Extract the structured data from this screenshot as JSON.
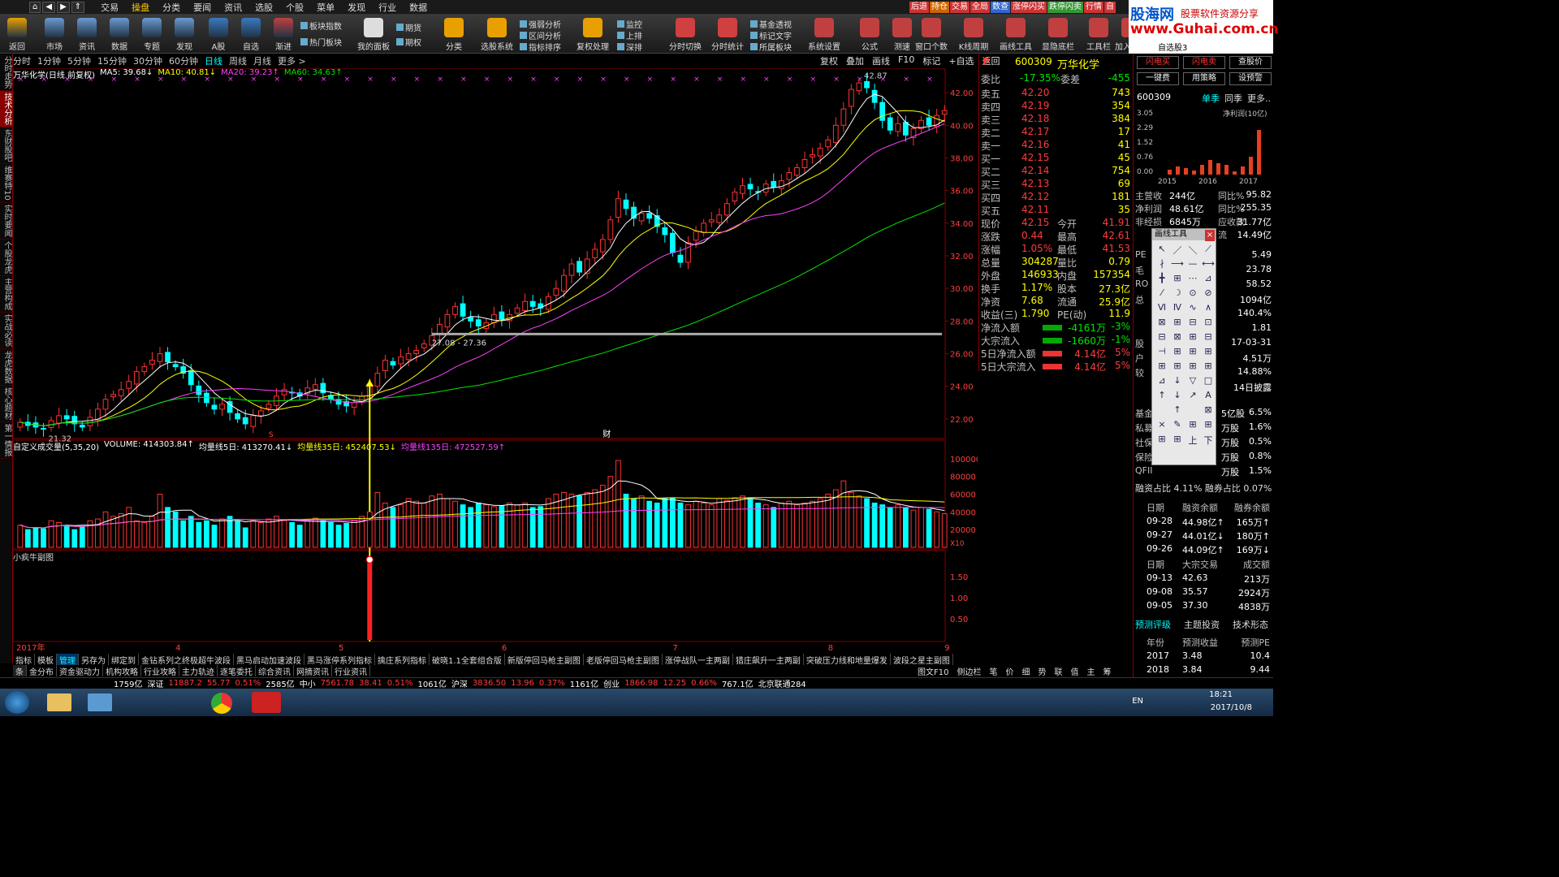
{
  "menu": {
    "items": [
      "交易",
      "操盘",
      "分类",
      "要闻",
      "资讯",
      "选股",
      "个股",
      "菜单",
      "发现",
      "行业",
      "数据"
    ],
    "active": "操盘",
    "tags": [
      "后退",
      "持仓",
      "交易",
      "全局",
      "数查",
      "涨停闪买",
      "跌停闪卖",
      "行情",
      "自"
    ]
  },
  "toolbar": {
    "big": [
      "返回",
      "市场",
      "资讯",
      "数据",
      "专题",
      "发现",
      "A股",
      "自选",
      "渐进"
    ],
    "small_left": [
      "板块指数",
      "热门板块"
    ],
    "panel": "我的面板",
    "futures": [
      "期货",
      "期权"
    ],
    "fenlei": "分类",
    "analysis": [
      "强弱分析",
      "区间分析",
      "指标排序"
    ],
    "select": "选股系统",
    "fuquan": "复权处理",
    "monitor": [
      "监控",
      "上排",
      "深排"
    ],
    "fenshi": [
      "分时切换",
      "分时统计"
    ],
    "jijin": [
      "基金透视",
      "标记文字",
      "所属板块"
    ],
    "more": [
      "系统设置",
      "公式",
      "测速",
      "窗口个数",
      "K线周期",
      "画线工具",
      "显隐底栏",
      "工具栏",
      "加入自选",
      "自选股3"
    ]
  },
  "brand": {
    "line1": "股海网",
    "line2": "股票软件资源分享",
    "line3": "www.Guhai.com.cn"
  },
  "periods": [
    "分时",
    "1分钟",
    "5分钟",
    "15分钟",
    "30分钟",
    "60分钟",
    "日线",
    "周线",
    "月线",
    "更多 >"
  ],
  "period_selected": "日线",
  "chart_buttons": [
    "复权",
    "叠加",
    "画线",
    "F10",
    "标记",
    "+自选",
    "返回"
  ],
  "left_tabs": [
    "分时走势",
    "技术分析",
    "东财股吧",
    "维赛特10",
    "实时要闻",
    "个股龙虎",
    "主营构成",
    "实战必读",
    "龙虎数据",
    "核心题材",
    "第一情报"
  ],
  "ma_legend": {
    "title": "万华化学(日线 前复权)",
    "ma5": "MA5: 39.68↓",
    "ma10": "MA10: 40.81↓",
    "ma20": "MA20: 39.23↑",
    "ma60": "MA60: 34.63↑",
    "colors": {
      "ma5": "#ffffff",
      "ma10": "#ffff00",
      "ma20": "#ff40ff",
      "ma60": "#00e600"
    }
  },
  "vol_legend": {
    "title": "自定义成交量(5,35,20)",
    "vol": "VOLUME: 414303.84↑",
    "v5": "均量线5日: 413270.41↓",
    "v35": "均量线35日: 452407.53↓",
    "v135": "均量线135日: 472527.59↑"
  },
  "indicator_name": "小疯牛副图",
  "price_axis": [
    "42.00",
    "40.00",
    "38.00",
    "36.00",
    "34.00",
    "32.00",
    "30.00",
    "28.00",
    "26.00",
    "24.00",
    "22.00"
  ],
  "vol_axis": [
    "100000",
    "80000",
    "60000",
    "40000",
    "20000"
  ],
  "vol_unit": "X10",
  "ind_axis": [
    "1.50",
    "1.00",
    "0.50"
  ],
  "month_labels": [
    "2017年",
    "4",
    "5",
    "6",
    "7",
    "8",
    "9"
  ],
  "annotations": {
    "low": "21.32",
    "high": "42.87",
    "range": "27.08 - 27.36",
    "marker": "财",
    "marker2": "S"
  },
  "chart_data": {
    "type": "candlestick",
    "title": "万华化学(日线 前复权)",
    "ylim": [
      21,
      43
    ],
    "closes": [
      21.8,
      21.6,
      21.5,
      21.4,
      21.9,
      22.2,
      22.0,
      21.7,
      21.5,
      22.1,
      22.6,
      23.2,
      23.5,
      23.8,
      24.3,
      24.9,
      25.2,
      25.6,
      26.0,
      25.5,
      25.2,
      24.8,
      24.1,
      23.5,
      23.0,
      22.6,
      22.9,
      22.4,
      22.0,
      21.7,
      22.2,
      22.5,
      22.9,
      23.4,
      23.8,
      23.6,
      23.4,
      23.9,
      24.1,
      23.6,
      23.2,
      22.9,
      22.8,
      23.0,
      23.4,
      24.0,
      24.8,
      25.6,
      25.3,
      25.8,
      26.0,
      26.2,
      26.6,
      27.1,
      27.8,
      28.4,
      28.9,
      28.3,
      28.0,
      27.7,
      27.9,
      28.4,
      28.1,
      28.4,
      28.8,
      29.2,
      28.9,
      28.8,
      29.5,
      30.0,
      30.8,
      31.5,
      31.0,
      31.8,
      32.4,
      33.0,
      34.2,
      35.5,
      34.9,
      34.3,
      34.6,
      34.3,
      33.8,
      33.3,
      32.2,
      31.6,
      32.8,
      33.5,
      34.0,
      34.2,
      34.5,
      35.2,
      35.9,
      36.3,
      36.1,
      35.9,
      36.4,
      36.2,
      36.6,
      37.1,
      37.4,
      37.9,
      38.2,
      38.6,
      39.1,
      40.0,
      41.0,
      42.2,
      42.6,
      42.3,
      41.4,
      40.3,
      39.7,
      40.1,
      39.4,
      39.8,
      40.3,
      40.0,
      40.6,
      40.9
    ],
    "volumes": [
      25000,
      20000,
      22000,
      21000,
      30000,
      28000,
      24000,
      20000,
      23000,
      30000,
      32000,
      40000,
      35000,
      38000,
      45000,
      30000,
      28000,
      35000,
      60000,
      45000,
      40000,
      30000,
      35000,
      28000,
      30000,
      25000,
      32000,
      35000,
      30000,
      22000,
      30000,
      28000,
      32000,
      35000,
      30000,
      28000,
      25000,
      30000,
      33000,
      30000,
      28000,
      25000,
      27000,
      30000,
      35000,
      40000,
      62000,
      50000,
      45000,
      48000,
      55000,
      52000,
      50000,
      58000,
      60000,
      55000,
      52000,
      48000,
      45000,
      50000,
      48000,
      46000,
      47000,
      50000,
      48000,
      50000,
      45000,
      46000,
      55000,
      60000,
      62000,
      60000,
      58000,
      62000,
      65000,
      70000,
      80000,
      98000,
      60000,
      55000,
      58000,
      52000,
      50000,
      55000,
      55000,
      50000,
      48000,
      52000,
      50000,
      48000,
      55000,
      53000,
      56000,
      58000,
      55000,
      50000,
      48000,
      45000,
      50000,
      52000,
      48000,
      50000,
      52000,
      55000,
      60000,
      65000,
      75000,
      62000,
      58000,
      55000,
      50000,
      48000,
      45000,
      48000,
      45000,
      42000,
      45000,
      43000,
      40000,
      38000
    ]
  },
  "quote": {
    "flag": "P",
    "code": "600309",
    "name": "万华化学",
    "weibi_label": "委比",
    "weibi": "-17.35%",
    "weicha_label": "委差",
    "weicha": "-455",
    "asks": [
      {
        "l": "卖五",
        "p": "42.20",
        "v": "743"
      },
      {
        "l": "卖四",
        "p": "42.19",
        "v": "354"
      },
      {
        "l": "卖三",
        "p": "42.18",
        "v": "384"
      },
      {
        "l": "卖二",
        "p": "42.17",
        "v": "17"
      },
      {
        "l": "卖一",
        "p": "42.16",
        "v": "41"
      }
    ],
    "bids": [
      {
        "l": "买一",
        "p": "42.15",
        "v": "45"
      },
      {
        "l": "买二",
        "p": "42.14",
        "v": "754"
      },
      {
        "l": "买三",
        "p": "42.13",
        "v": "69"
      },
      {
        "l": "买四",
        "p": "42.12",
        "v": "181"
      },
      {
        "l": "买五",
        "p": "42.11",
        "v": "35"
      }
    ],
    "stats": [
      {
        "a": "现价",
        "b": "42.15",
        "c": "今开",
        "d": "41.91"
      },
      {
        "a": "涨跌",
        "b": "0.44",
        "c": "最高",
        "d": "42.61"
      },
      {
        "a": "涨幅",
        "b": "1.05%",
        "c": "最低",
        "d": "41.53"
      },
      {
        "a": "总量",
        "b": "304287",
        "c": "量比",
        "d": "0.79"
      },
      {
        "a": "外盘",
        "b": "146933",
        "c": "内盘",
        "d": "157354"
      },
      {
        "a": "换手",
        "b": "1.17%",
        "c": "股本",
        "d": "27.3亿"
      },
      {
        "a": "净资",
        "b": "7.68",
        "c": "流通",
        "d": "25.9亿"
      },
      {
        "a": "收益(三)",
        "b": "1.790",
        "c": "PE(动)",
        "d": "11.9"
      }
    ],
    "flows": [
      {
        "a": "净流入额",
        "b": "-4161万",
        "c": "-3%"
      },
      {
        "a": "大宗流入",
        "b": "-1660万",
        "c": "-1%"
      },
      {
        "a": "5日净流入额",
        "b": "4.14亿",
        "c": "5%"
      },
      {
        "a": "5日大宗流入",
        "b": "4.14亿",
        "c": "5%"
      }
    ]
  },
  "rpanel": {
    "buttons": [
      "闪电买",
      "闪电卖",
      "查股价",
      "一键费",
      "用策略",
      "设预警"
    ],
    "code": "600309",
    "tabs": [
      "单季",
      "同季",
      "更多.."
    ],
    "chart_title": "净利润(10亿)",
    "chart_axis": [
      "3.05",
      "2.29",
      "1.52",
      "0.76",
      "0.00"
    ],
    "years": [
      "2015",
      "2016",
      "2017"
    ],
    "rows": [
      {
        "a": "主营收",
        "b": "244亿",
        "c": "同比%",
        "d": "95.82"
      },
      {
        "a": "净利润",
        "b": "48.61亿",
        "c": "同比%",
        "d": "255.35"
      },
      {
        "a": "非经损",
        "b": "6845万",
        "c": "应收款",
        "d": "31.77亿"
      },
      {
        "a": "",
        "b": "",
        "c": "流",
        "d": "14.49亿"
      }
    ],
    "partial": [
      {
        "a": "PE",
        "d": "5.49"
      },
      {
        "a": "毛",
        "d": "23.78"
      },
      {
        "a": "RO",
        "d": "58.52"
      },
      {
        "a": "总",
        "d": "1094亿"
      },
      {
        "a": "",
        "d": "140.4%"
      },
      {
        "a": "",
        "d": "1.81"
      },
      {
        "a": "股",
        "d": "17-03-31"
      },
      {
        "a": "户",
        "d": "4.51万"
      },
      {
        "a": "较",
        "d": "14.88%"
      },
      {
        "a": "",
        "d": "14日披露"
      }
    ],
    "holders": [
      {
        "a": "基金",
        "b": "5亿股",
        "c": "6.5%"
      },
      {
        "a": "私募",
        "b": "万股",
        "c": "1.6%"
      },
      {
        "a": "社保",
        "b": "万股",
        "c": "0.5%"
      },
      {
        "a": "保险",
        "b": "万股",
        "c": "0.8%"
      },
      {
        "a": "QFII",
        "b": "万股",
        "c": "1.5%"
      }
    ],
    "margin_text": "融资占比 4.11% 融券占比 0.07%",
    "margin_head": [
      "日期",
      "融资余额",
      "融券余额"
    ],
    "margin_rows": [
      [
        "09-28",
        "44.98亿↑",
        "165万↑"
      ],
      [
        "09-27",
        "44.01亿↓",
        "180万↑"
      ],
      [
        "09-26",
        "44.09亿↑",
        "169万↓"
      ]
    ],
    "block_head": [
      "日期",
      "大宗交易",
      "成交额"
    ],
    "block_rows": [
      [
        "09-13",
        "42.63",
        "213万"
      ],
      [
        "09-08",
        "35.57",
        "2924万"
      ],
      [
        "09-05",
        "37.30",
        "4838万"
      ]
    ],
    "rating_tabs": [
      "预测评级",
      "主题投资",
      "技术形态"
    ],
    "pred_head": [
      "年份",
      "预测收益",
      "预测PE"
    ],
    "pred_rows": [
      [
        "2017",
        "3.48",
        "10.4"
      ],
      [
        "2018",
        "3.84",
        "9.44"
      ]
    ]
  },
  "draw_tool_title": "画线工具",
  "bottom_tabs": [
    "指标",
    "模板",
    "管理",
    "另存为",
    "绑定到",
    "金钻系列之终极超牛波段",
    "黑马启动加速波段",
    "黑马涨停系列指标",
    "擒庄系列指标",
    "破晓1.1全套组合版",
    "新版停回马枪主副图",
    "老版停回马枪主副图",
    "涨停战队一主两副",
    "猎庄飙升一主两副",
    "突破压力线和地量爆发",
    "波段之星主副图"
  ],
  "bottom_tabs2": [
    "条",
    "金分布",
    "资金驱动力",
    "机构攻略",
    "行业攻略",
    "主力轨迹",
    "逐笔委托",
    "综合资讯",
    "网摘资讯",
    "行业资讯"
  ],
  "bottom_right": [
    "图文F10",
    "侧边栏",
    "笔",
    "价",
    "细",
    "势",
    "联",
    "值",
    "主",
    "筹"
  ],
  "statusbar": [
    {
      "t": "1759亿",
      "c": "wht"
    },
    {
      "t": "深证",
      "c": "wht"
    },
    {
      "t": "11887.2",
      "c": "red"
    },
    {
      "t": "55.77",
      "c": "red"
    },
    {
      "t": "0.51%",
      "c": "red"
    },
    {
      "t": "2585亿",
      "c": "wht"
    },
    {
      "t": "中小",
      "c": "wht"
    },
    {
      "t": "7561.78",
      "c": "red"
    },
    {
      "t": "38.41",
      "c": "red"
    },
    {
      "t": "0.51%",
      "c": "red"
    },
    {
      "t": "1061亿",
      "c": "wht"
    },
    {
      "t": "沪深",
      "c": "wht"
    },
    {
      "t": "3836.50",
      "c": "red"
    },
    {
      "t": "13.96",
      "c": "red"
    },
    {
      "t": "0.37%",
      "c": "red"
    },
    {
      "t": "1161亿",
      "c": "wht"
    },
    {
      "t": "创业",
      "c": "wht"
    },
    {
      "t": "1866.98",
      "c": "red"
    },
    {
      "t": "12.25",
      "c": "red"
    },
    {
      "t": "0.66%",
      "c": "red"
    },
    {
      "t": "767.1亿",
      "c": "wht"
    },
    {
      "t": "北京联通284",
      "c": "wht"
    }
  ],
  "taskbar": {
    "time": "18:21",
    "date": "2017/10/8",
    "lang": "EN"
  }
}
